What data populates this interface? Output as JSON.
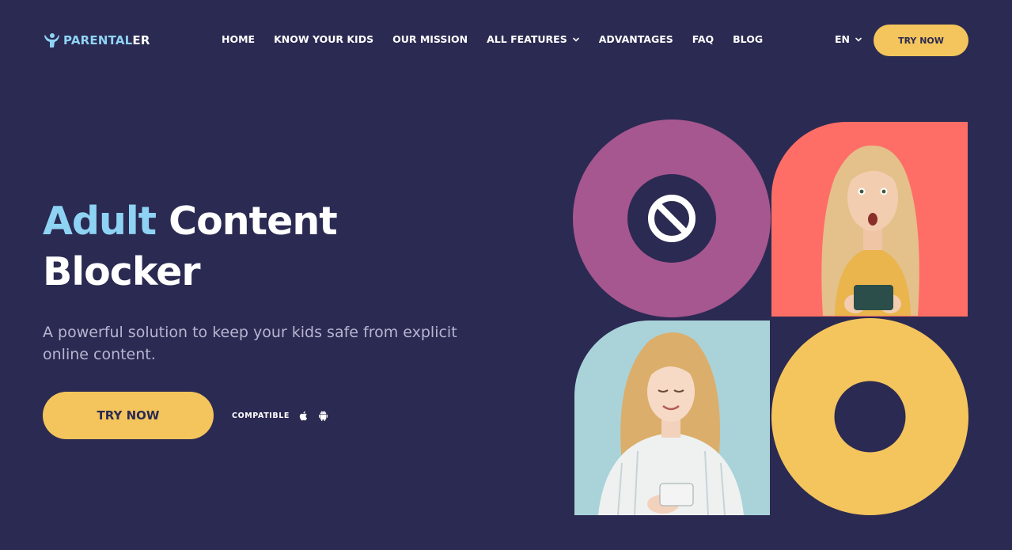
{
  "brand": {
    "part1": "PARENTAL",
    "part2": "ER"
  },
  "nav": {
    "items": [
      {
        "label": "HOME"
      },
      {
        "label": "KNOW YOUR KIDS"
      },
      {
        "label": "OUR MISSION"
      },
      {
        "label": "ALL FEATURES",
        "has_dropdown": true
      },
      {
        "label": "ADVANTAGES"
      },
      {
        "label": "FAQ"
      },
      {
        "label": "BLOG"
      }
    ],
    "language": "EN",
    "cta_label": "TRY NOW"
  },
  "hero": {
    "title_accent": "Adult",
    "title_rest": "Content",
    "title_line2": "Blocker",
    "subtitle": "A powerful solution to keep your kids safe from explicit online content.",
    "cta_label": "TRY NOW",
    "compatible_label": "COMPATIBLE",
    "platform_icons": [
      "apple-icon",
      "android-icon"
    ]
  },
  "graphic": {
    "tiles": [
      "block-symbol-circle",
      "surprised-girl-photo",
      "smiling-woman-photo",
      "yellow-ring"
    ],
    "colors": {
      "background": "#2b2a52",
      "magenta": "#a6578f",
      "coral": "#fe6e66",
      "light_blue": "#a9d3d9",
      "yellow": "#f4c55c",
      "accent_blue": "#8fd3f4"
    }
  }
}
